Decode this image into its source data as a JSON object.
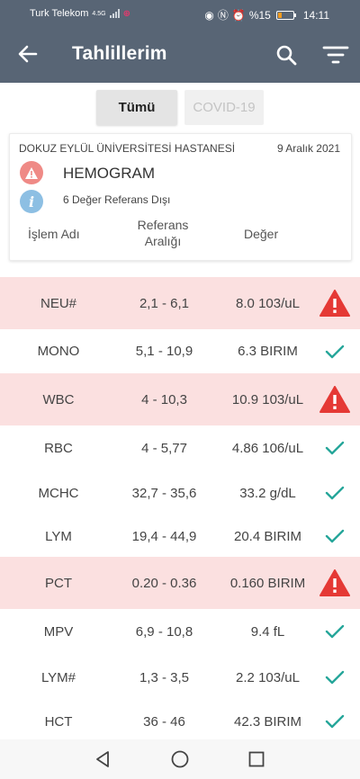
{
  "status_bar": {
    "carrier": "Turk Telekom",
    "network": "4.5G",
    "battery_percent": "%15",
    "time": "14:11"
  },
  "header": {
    "title": "Tahlillerim",
    "back_icon": "arrow-left-icon",
    "search_icon": "search-icon",
    "filter_icon": "filter-icon"
  },
  "tabs": [
    {
      "label": "Tümü",
      "active": true
    },
    {
      "label": "COVID-19",
      "active": false
    }
  ],
  "card": {
    "hospital": "DOKUZ EYLÜL ÜNİVERSİTESİ HASTANESİ",
    "date": "9 Aralık 2021",
    "test_name": "HEMOGRAM",
    "out_of_range": "6 Değer Referans Dışı",
    "columns": {
      "name": "İşlem Adı",
      "reference_line1": "Referans",
      "reference_line2": "Aralığı",
      "value": "Değer"
    }
  },
  "results": [
    {
      "name": "NEU#",
      "reference": "2,1 - 6,1",
      "value": "8.0 103/uL",
      "status": "alert"
    },
    {
      "name": "MONO",
      "reference": "5,1 - 10,9",
      "value": "6.3 BIRIM",
      "status": "ok"
    },
    {
      "name": "WBC",
      "reference": "4 - 10,3",
      "value": "10.9 103/uL",
      "status": "alert"
    },
    {
      "name": "RBC",
      "reference": "4 - 5,77",
      "value": "4.86 106/uL",
      "status": "ok"
    },
    {
      "name": "MCHC",
      "reference": "32,7 - 35,6",
      "value": "33.2 g/dL",
      "status": "ok"
    },
    {
      "name": "LYM",
      "reference": "19,4 - 44,9",
      "value": "20.4 BIRIM",
      "status": "ok"
    },
    {
      "name": "PCT",
      "reference": "0.20 - 0.36",
      "value": "0.160 BIRIM",
      "status": "alert"
    },
    {
      "name": "MPV",
      "reference": "6,9 - 10,8",
      "value": "9.4 fL",
      "status": "ok"
    },
    {
      "name": "LYM#",
      "reference": "1,3 - 3,5",
      "value": "2.2 103/uL",
      "status": "ok"
    },
    {
      "name": "HCT",
      "reference": "36 - 46",
      "value": "42.3 BIRIM",
      "status": "ok"
    }
  ],
  "colors": {
    "app_bar": "#586575",
    "alert_row": "#fbe0e0",
    "alert_icon": "#e53935",
    "ok_icon": "#26a69a",
    "warn_circle": "#ef8a86",
    "info_circle": "#8dbfe3"
  }
}
